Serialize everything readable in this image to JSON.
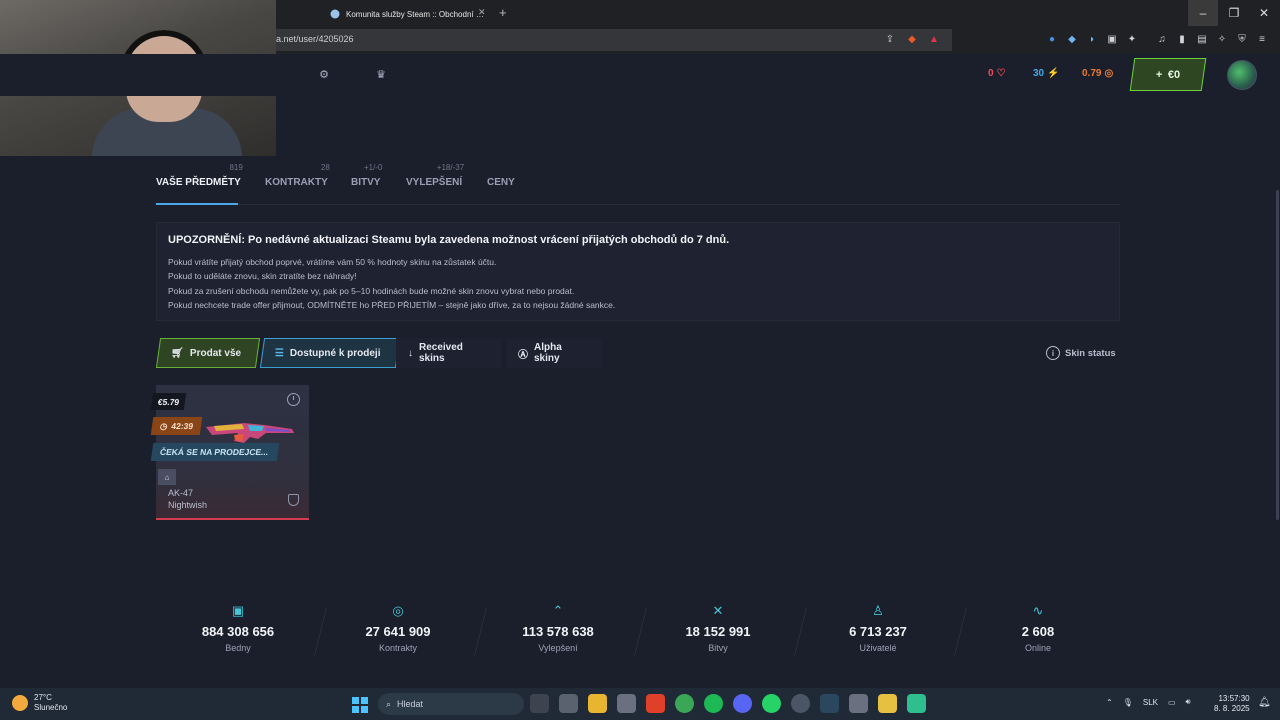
{
  "browser": {
    "tab_title": "Komunita služby Steam :: Obchodní …",
    "url": "a.net/user/4205026"
  },
  "header": {
    "hearts": "0",
    "bolts": "30",
    "coins": "0.79",
    "balance": "€0"
  },
  "tabs": [
    {
      "label": "VAŠE PŘEDMĚTY",
      "count": "819"
    },
    {
      "label": "KONTRAKTY",
      "count": "28"
    },
    {
      "label": "BITVY",
      "count": "+1/-0"
    },
    {
      "label": "VYLEPŠENÍ",
      "count": "+18/-37"
    },
    {
      "label": "CENY",
      "count": ""
    }
  ],
  "notice": {
    "title": "UPOZORNĚNÍ: Po nedávné aktualizaci Steamu byla zavedena možnost vrácení přijatých obchodů do 7 dnů.",
    "lines": [
      "Pokud vrátíte přijatý obchod poprvé, vrátíme vám 50 % hodnoty skinu na zůstatek účtu.",
      "Pokud to uděláte znovu, skin ztratíte bez náhrady!",
      "Pokud za zrušení obchodu nemůžete vy, pak po 5–10 hodinách bude možné skin znovu vybrat nebo prodat.",
      "Pokud nechcete trade offer přijmout, ODMÍTNĚTE ho PŘED PŘIJETÍM – stejně jako dříve, za to nejsou žádné sankce."
    ]
  },
  "filters": {
    "sell_all": "Prodat vše",
    "available": "Dostupné k prodeji",
    "received": "Received skins",
    "alpha": "Alpha skiny",
    "skin_status": "Skin status"
  },
  "item": {
    "price": "€5.79",
    "timer": "42:39",
    "status": "ČEKÁ SE NA PRODEJCE...",
    "weapon": "AK-47",
    "skin": "Nightwish"
  },
  "stats": [
    {
      "icon": "box-icon",
      "value": "884 308 656",
      "label": "Bedny"
    },
    {
      "icon": "target-icon",
      "value": "27 641 909",
      "label": "Kontrakty"
    },
    {
      "icon": "upgrade-icon",
      "value": "113 578 638",
      "label": "Vylepšení"
    },
    {
      "icon": "swords-icon",
      "value": "18 152 991",
      "label": "Bitvy"
    },
    {
      "icon": "user-icon",
      "value": "6 713 237",
      "label": "Uživatelé"
    },
    {
      "icon": "pulse-icon",
      "value": "2 608",
      "label": "Online"
    }
  ],
  "taskbar": {
    "temp": "27°C",
    "weather": "Slunečno",
    "search": "Hledat",
    "lang": "SLK",
    "time": "13:57:30",
    "date": "8. 8. 2025"
  },
  "colors": {
    "accent_green": "#6bd23a",
    "accent_blue": "#4aa8e8",
    "stat_icon": "#45c6d6"
  }
}
